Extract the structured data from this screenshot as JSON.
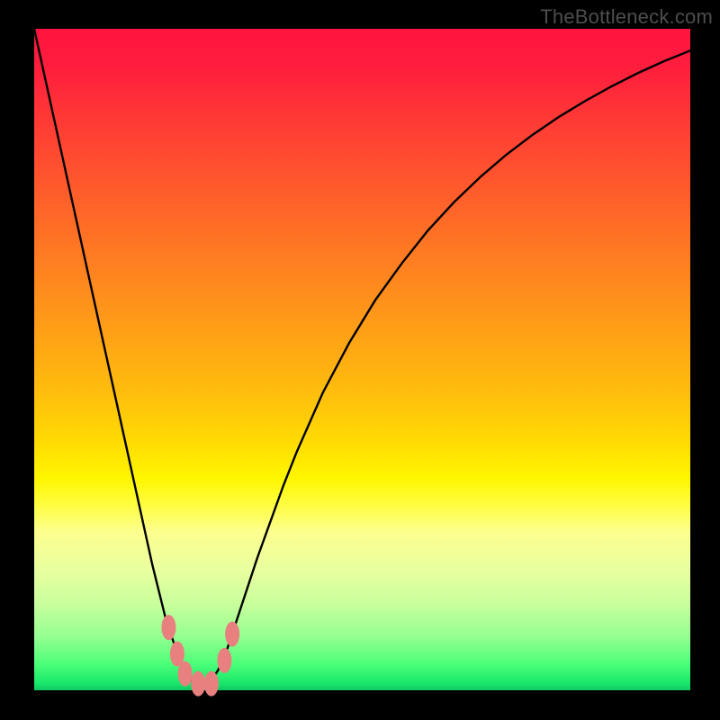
{
  "watermark": "TheBottleneck.com",
  "colors": {
    "frame": "#000000",
    "curve_stroke": "#000000",
    "marker_fill": "#e98080",
    "marker_stroke": "#c96a6a"
  },
  "chart_data": {
    "type": "line",
    "title": "",
    "xlabel": "",
    "ylabel": "",
    "xlim": [
      0,
      100
    ],
    "ylim": [
      0,
      100
    ],
    "grid": false,
    "legend": false,
    "x": [
      0,
      2,
      4,
      6,
      8,
      10,
      12,
      14,
      16,
      18,
      20,
      21,
      22,
      23,
      24,
      25,
      26,
      27,
      28,
      29,
      30,
      32,
      34,
      36,
      38,
      40,
      44,
      48,
      52,
      56,
      60,
      64,
      68,
      72,
      76,
      80,
      84,
      88,
      92,
      96,
      100
    ],
    "y": [
      100,
      91,
      82,
      73,
      64,
      55,
      46,
      37,
      28,
      19,
      11,
      8,
      5,
      3,
      1.5,
      1,
      1,
      1.5,
      3,
      5,
      8,
      14,
      20,
      25.5,
      31,
      36,
      45,
      52.5,
      59,
      64.5,
      69.5,
      73.8,
      77.6,
      81,
      84,
      86.7,
      89.1,
      91.3,
      93.3,
      95.1,
      96.7
    ],
    "series": [
      {
        "name": "bottleneck-curve",
        "x": [
          0,
          2,
          4,
          6,
          8,
          10,
          12,
          14,
          16,
          18,
          20,
          21,
          22,
          23,
          24,
          25,
          26,
          27,
          28,
          29,
          30,
          32,
          34,
          36,
          38,
          40,
          44,
          48,
          52,
          56,
          60,
          64,
          68,
          72,
          76,
          80,
          84,
          88,
          92,
          96,
          100
        ],
        "y": [
          100,
          91,
          82,
          73,
          64,
          55,
          46,
          37,
          28,
          19,
          11,
          8,
          5,
          3,
          1.5,
          1,
          1,
          1.5,
          3,
          5,
          8,
          14,
          20,
          25.5,
          31,
          36,
          45,
          52.5,
          59,
          64.5,
          69.5,
          73.8,
          77.6,
          81,
          84,
          86.7,
          89.1,
          91.3,
          93.3,
          95.1,
          96.7
        ]
      }
    ],
    "markers": [
      {
        "x": 20.5,
        "y": 9.5
      },
      {
        "x": 21.8,
        "y": 5.5
      },
      {
        "x": 23.0,
        "y": 2.5
      },
      {
        "x": 25.0,
        "y": 1.0
      },
      {
        "x": 27.0,
        "y": 1.0
      },
      {
        "x": 29.0,
        "y": 4.5
      },
      {
        "x": 30.2,
        "y": 8.5
      }
    ]
  }
}
